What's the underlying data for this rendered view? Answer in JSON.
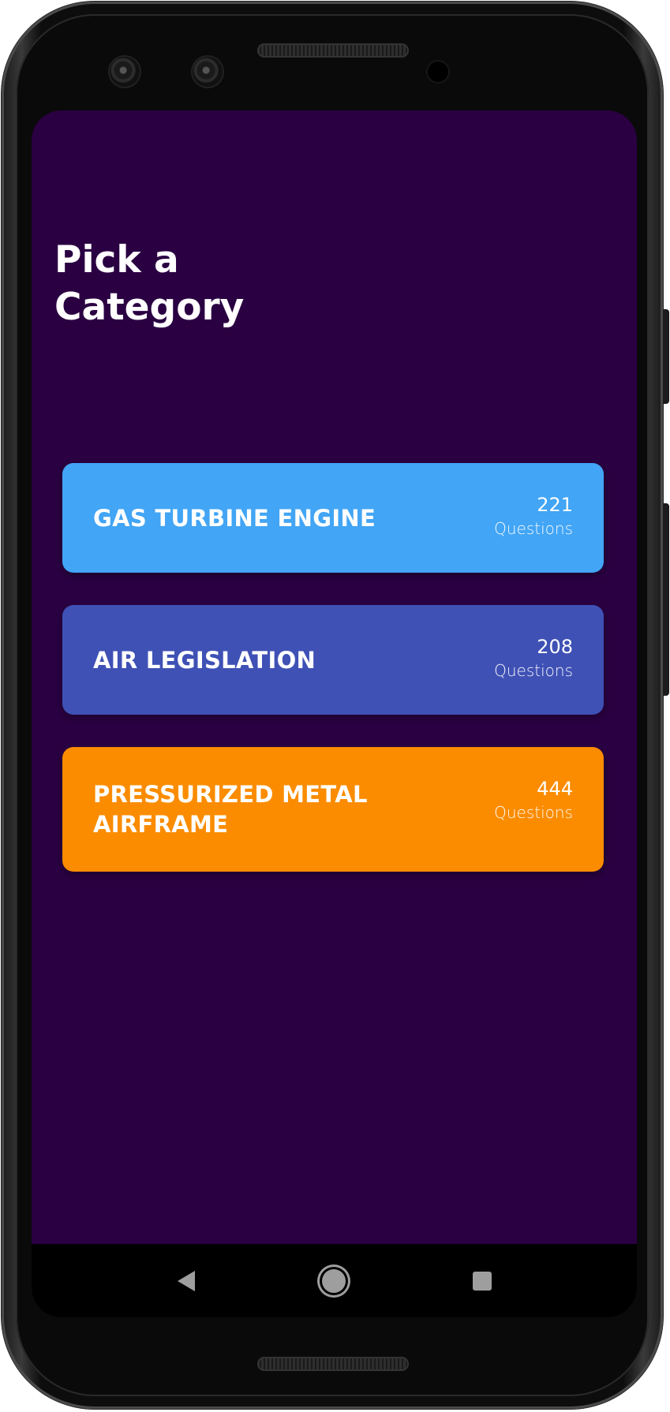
{
  "screen": {
    "background": "#2a0042",
    "title": "Pick a Category"
  },
  "categories": [
    {
      "name": "GAS TURBINE ENGINE",
      "count": "221",
      "unit": "Questions",
      "color": "#42a5f5"
    },
    {
      "name": "AIR LEGISLATION",
      "count": "208",
      "unit": "Questions",
      "color": "#3f51b5"
    },
    {
      "name": "PRESSURIZED METAL AIRFRAME",
      "count": "444",
      "unit": "Questions",
      "color": "#fb8c00"
    }
  ],
  "navbar": {
    "buttons": [
      {
        "icon": "back-triangle-icon"
      },
      {
        "icon": "home-circle-icon"
      },
      {
        "icon": "recents-square-icon"
      }
    ]
  }
}
